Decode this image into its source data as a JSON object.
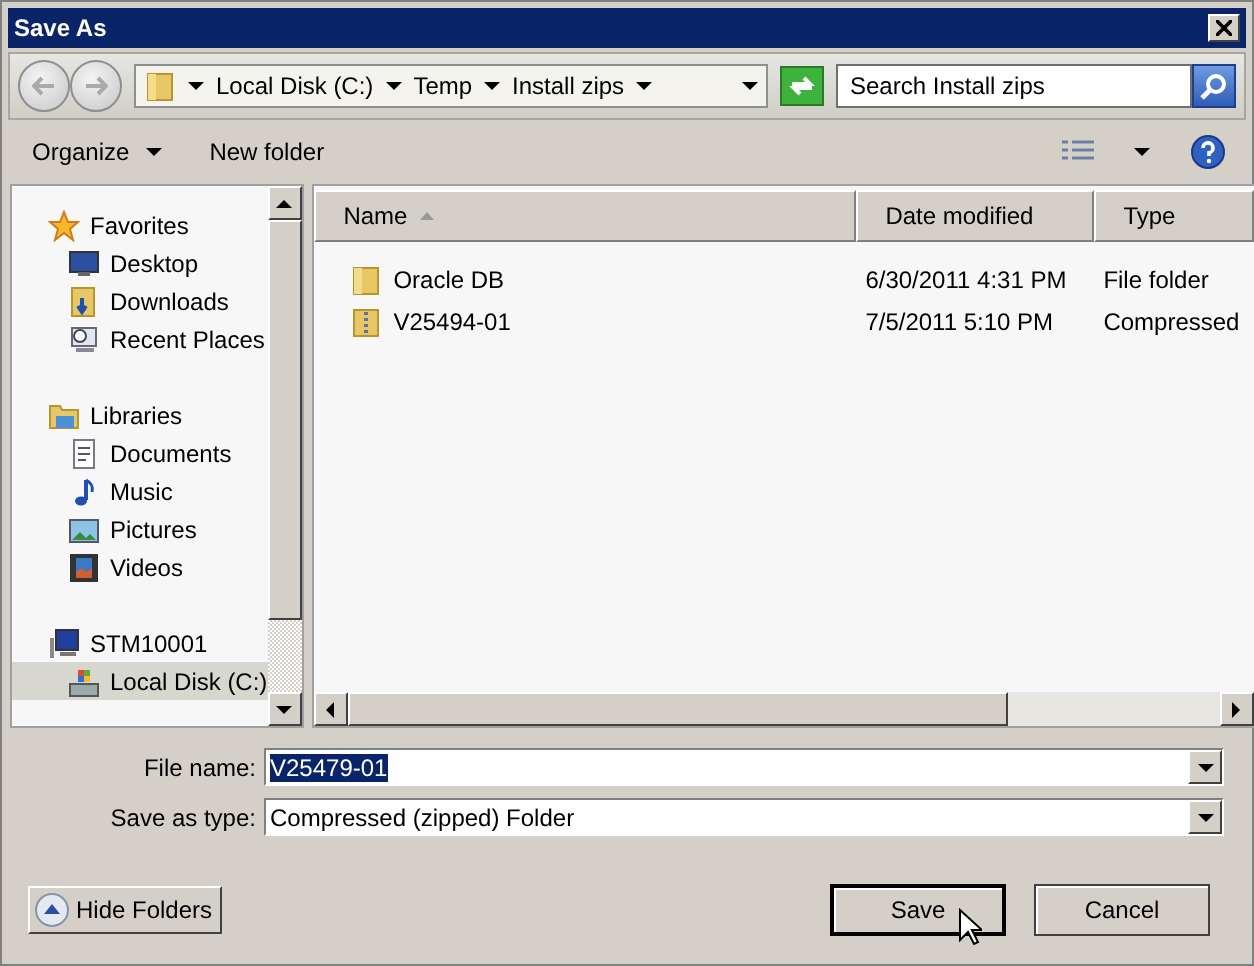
{
  "window": {
    "title": "Save As"
  },
  "address": {
    "crumbs": [
      "Local Disk (C:)",
      "Temp",
      "Install zips"
    ]
  },
  "search": {
    "placeholder": "Search Install zips"
  },
  "toolbar": [
    {
      "label": "Organize",
      "dropdown": true
    },
    {
      "label": "New folder",
      "dropdown": false
    }
  ],
  "nav": [
    {
      "label": "Favorites",
      "children": [
        {
          "label": "Desktop",
          "selected": false
        },
        {
          "label": "Downloads",
          "selected": false
        },
        {
          "label": "Recent Places",
          "selected": false
        }
      ]
    },
    {
      "label": "Libraries",
      "children": [
        {
          "label": "Documents",
          "selected": false
        },
        {
          "label": "Music",
          "selected": false
        },
        {
          "label": "Pictures",
          "selected": false
        },
        {
          "label": "Videos",
          "selected": false
        }
      ]
    },
    {
      "label": "STM10001",
      "children": [
        {
          "label": "Local Disk (C:)",
          "selected": true
        }
      ]
    }
  ],
  "columns": [
    {
      "label": "Name",
      "sorted": true
    },
    {
      "label": "Date modified",
      "sorted": false
    },
    {
      "label": "Type",
      "sorted": false
    }
  ],
  "files": [
    {
      "name": "Oracle DB",
      "date": "6/30/2011 4:31 PM",
      "type": "File folder",
      "kind": "folder"
    },
    {
      "name": "V25494-01",
      "date": "7/5/2011 5:10 PM",
      "type": "Compressed",
      "kind": "zip"
    }
  ],
  "form": [
    {
      "label": "File name:",
      "value": "V25479-01",
      "selected": true
    },
    {
      "label": "Save as type:",
      "value": "Compressed (zipped) Folder",
      "selected": false
    }
  ],
  "hide_folders": "Hide Folders",
  "buttons": [
    {
      "label": "Save",
      "default": true
    },
    {
      "label": "Cancel",
      "default": false
    }
  ]
}
